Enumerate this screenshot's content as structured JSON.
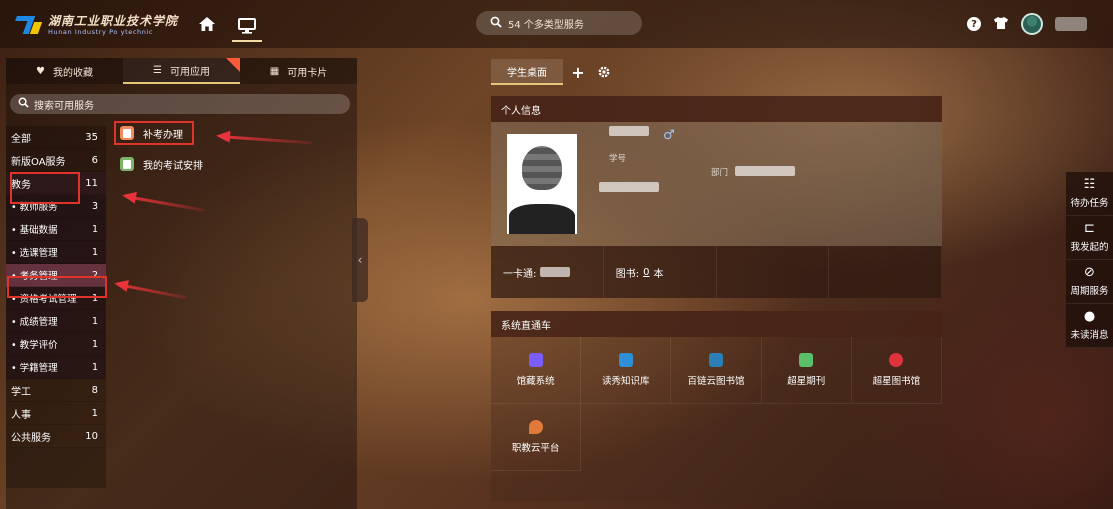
{
  "header": {
    "logo_cn": "湖南工业职业技术学院",
    "logo_en": "Hunan Industry Po ytechnic",
    "search_placeholder": "54 个多类型服务"
  },
  "left": {
    "tabs": [
      {
        "label": "我的收藏",
        "icon": "heart-icon"
      },
      {
        "label": "可用应用",
        "icon": "list-icon",
        "active": true
      },
      {
        "label": "可用卡片",
        "icon": "grid-icon"
      }
    ],
    "search_label": "搜索可用服务",
    "categories": [
      {
        "label": "全部",
        "count": "35"
      },
      {
        "label": "新版OA服务",
        "count": "6"
      },
      {
        "label": "教务",
        "count": "11"
      },
      {
        "label": "• 教师服务",
        "count": "3"
      },
      {
        "label": "• 基础数据",
        "count": "1"
      },
      {
        "label": "• 选课管理",
        "count": "1"
      },
      {
        "label": "• 考务管理",
        "count": "2"
      },
      {
        "label": "• 资格考试管理",
        "count": "1"
      },
      {
        "label": "• 成绩管理",
        "count": "1"
      },
      {
        "label": "• 教学评价",
        "count": "1"
      },
      {
        "label": "• 学籍管理",
        "count": "1"
      },
      {
        "label": "学工",
        "count": "8"
      },
      {
        "label": "人事",
        "count": "1"
      },
      {
        "label": "公共服务",
        "count": "10"
      }
    ],
    "apps": [
      {
        "label": "补考办理",
        "icon": "exam-doc-icon"
      },
      {
        "label": "我的考试安排",
        "icon": "schedule-doc-icon"
      }
    ]
  },
  "desk": {
    "tab_label": "学生桌面",
    "add_label": "+",
    "settings_icon": "gear-icon"
  },
  "profile": {
    "header": "个人信息",
    "xuehao_label": "学号",
    "bumen_label": "部门",
    "card_label": "一卡通:",
    "books_label": "图书:",
    "books_value": "0",
    "books_unit": "本"
  },
  "express": {
    "header": "系统直通车",
    "items": [
      {
        "label": "馆藏系统",
        "color": "#7b5cff"
      },
      {
        "label": "读秀知识库",
        "color": "#2f8fd8"
      },
      {
        "label": "百链云图书馆",
        "color": "#2b7fb6"
      },
      {
        "label": "超星期刊",
        "color": "#5bbf6a"
      },
      {
        "label": "超星图书馆",
        "color": "#e0323c"
      },
      {
        "label": "职教云平台",
        "color": "#e07a3a"
      }
    ]
  },
  "right": {
    "items": [
      {
        "label": "待办任务",
        "icon": "task-list-icon"
      },
      {
        "label": "我发起的",
        "icon": "share-icon"
      },
      {
        "label": "周期服务",
        "icon": "cycle-check-icon"
      },
      {
        "label": "未读消息",
        "icon": "chat-bubble-icon"
      }
    ]
  }
}
